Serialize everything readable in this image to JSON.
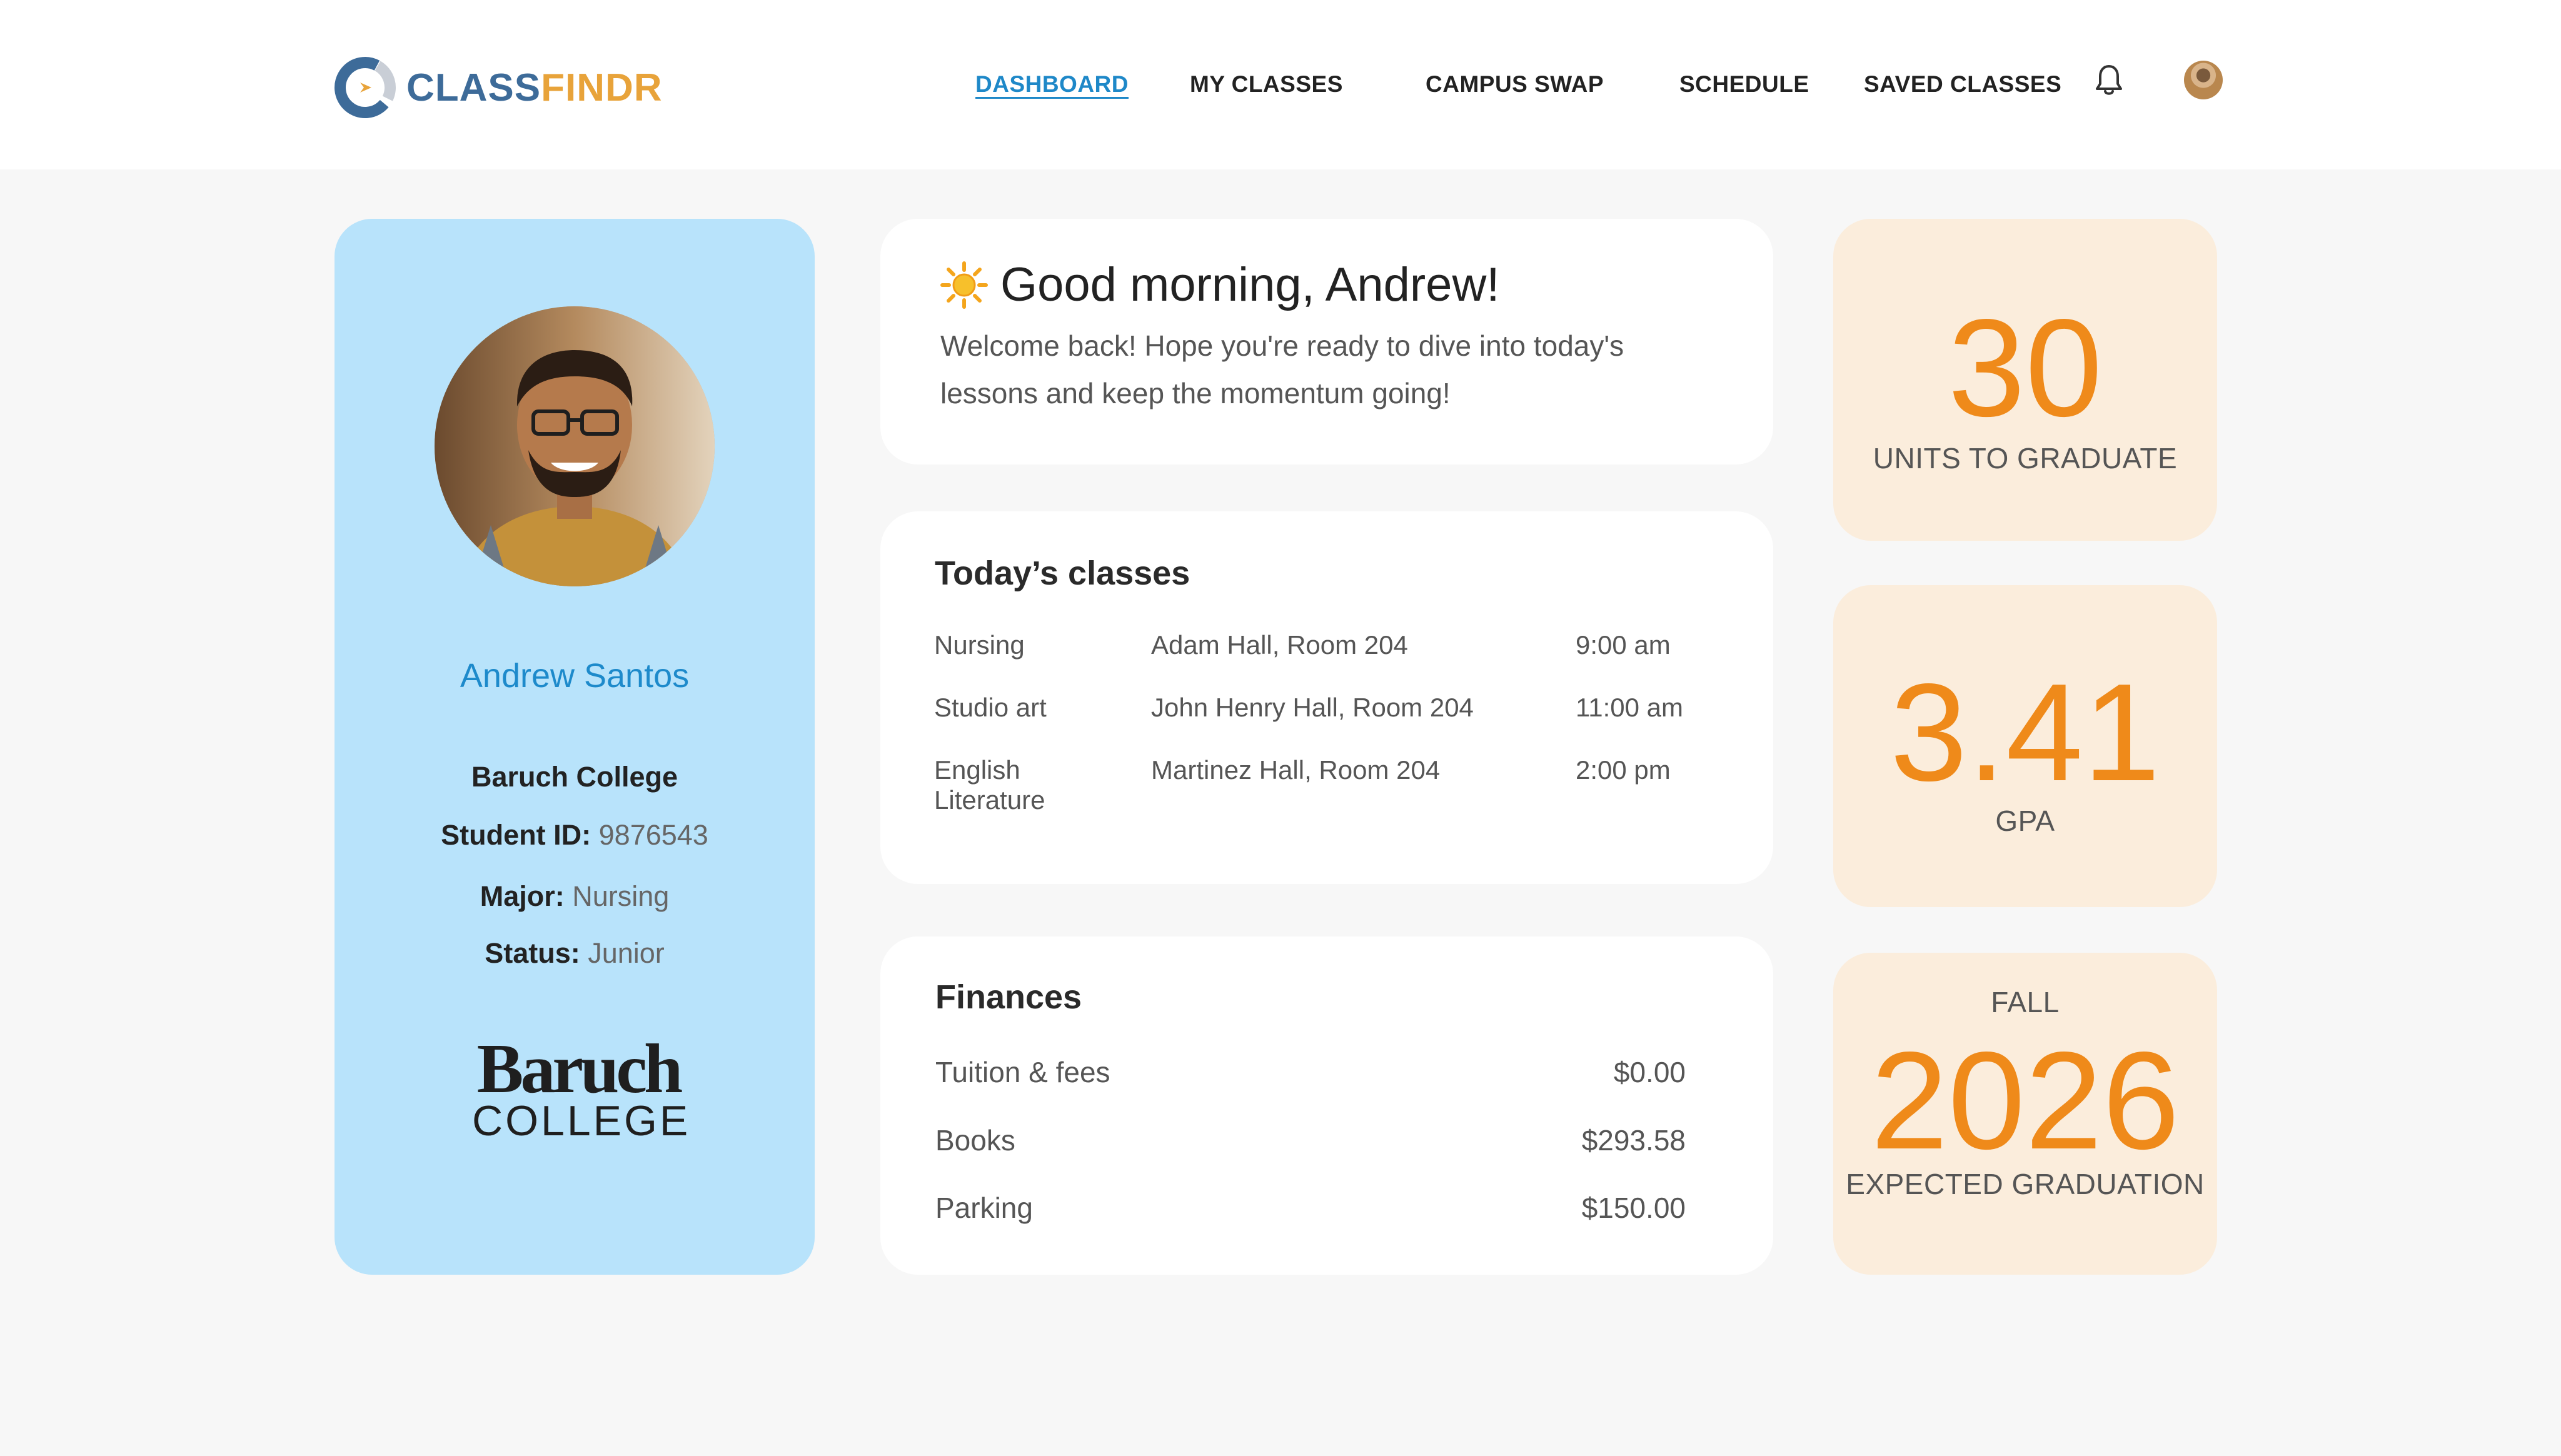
{
  "brand": {
    "part1": "CLASS",
    "part2": "FINDR"
  },
  "nav": [
    {
      "label": "DASHBOARD",
      "active": true
    },
    {
      "label": "MY CLASSES"
    },
    {
      "label": "CAMPUS SWAP"
    },
    {
      "label": "SCHEDULE"
    },
    {
      "label": "SAVED CLASSES"
    }
  ],
  "icons": {
    "notifications": "bell-icon",
    "greeting": "sun-icon",
    "profile": "avatar"
  },
  "profile": {
    "name": "Andrew Santos",
    "college": "Baruch College",
    "student_id_label": "Student ID:",
    "student_id": "9876543",
    "major_label": "Major:",
    "major": "Nursing",
    "status_label": "Status:",
    "status": "Junior",
    "seal_top": "Baruch",
    "seal_bottom": "COLLEGE"
  },
  "greeting": {
    "title": "Good morning, Andrew!",
    "body": "Welcome back! Hope you're ready to dive into today's lessons and keep the momentum going!"
  },
  "classes": {
    "title": "Today’s classes",
    "rows": [
      {
        "course": "Nursing",
        "room": "Adam Hall, Room 204",
        "time": "9:00 am"
      },
      {
        "course": "Studio art",
        "room": "John Henry Hall, Room 204",
        "time": "11:00 am"
      },
      {
        "course": "English Literature",
        "room": "Martinez Hall, Room 204",
        "time": "2:00 pm"
      }
    ]
  },
  "finances": {
    "title": "Finances",
    "rows": [
      {
        "label": "Tuition & fees",
        "amount": "$0.00"
      },
      {
        "label": "Books",
        "amount": "$293.58"
      },
      {
        "label": "Parking",
        "amount": "$150.00"
      }
    ]
  },
  "stats": {
    "units": {
      "value": "30",
      "label": "UNITS TO GRADUATE"
    },
    "gpa": {
      "value": "3.41",
      "label": "GPA"
    },
    "graduation": {
      "term": "FALL",
      "value": "2026",
      "label": "EXPECTED GRADUATION"
    }
  },
  "colors": {
    "accent_blue": "#1d8acb",
    "profile_bg": "#b8e3fb",
    "stat_bg": "#fbeddc",
    "stat_number": "#ef8a1a",
    "logo_blue": "#3d6b99",
    "logo_gold": "#e8a33a"
  }
}
